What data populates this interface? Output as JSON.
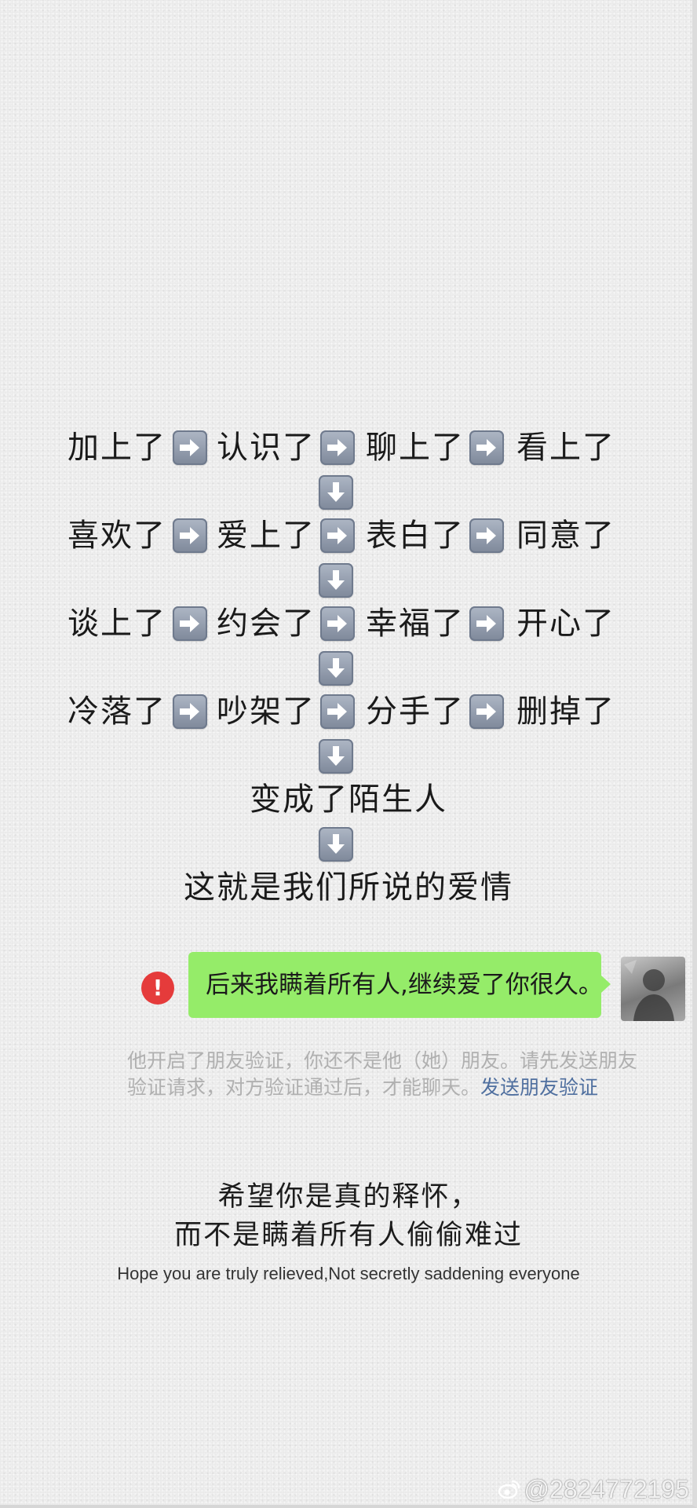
{
  "flow": {
    "rows": [
      [
        "加上了",
        "认识了",
        "聊上了",
        "看上了"
      ],
      [
        "喜欢了",
        "爱上了",
        "表白了",
        "同意了"
      ],
      [
        "谈上了",
        "约会了",
        "幸福了",
        "开心了"
      ],
      [
        "冷落了",
        "吵架了",
        "分手了",
        "删掉了"
      ]
    ],
    "line5": "变成了陌生人",
    "line6": "这就是我们所说的爱情",
    "icons": {
      "right": "right-arrow-icon",
      "down": "down-arrow-icon"
    }
  },
  "chat": {
    "message": "后来我瞒着所有人,继续爱了你很久。",
    "error_icon": "!",
    "bubble_color": "#95ec69",
    "error_color": "#e53b3b",
    "system_note": "他开启了朋友验证，你还不是他（她）朋友。请先发送朋友验证请求，对方验证通过后，才能聊天。",
    "system_link": "发送朋友验证",
    "link_color": "#4f6f9f"
  },
  "quote": {
    "line1": "希望你是真的释怀，",
    "line2": "而不是瞒着所有人偷偷难过",
    "english": "Hope you are truly relieved,Not secretly saddening everyone"
  },
  "watermark": {
    "text": "@2824772195"
  }
}
